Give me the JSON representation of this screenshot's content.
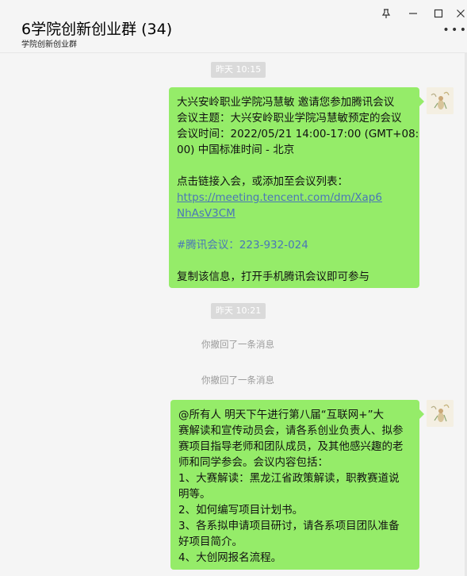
{
  "header": {
    "title": "6学院创新创业群 (34)",
    "subtitle": "学院创新创业群"
  },
  "window_controls": {
    "pin_icon": "pin-icon",
    "minimize": "—",
    "maximize": "☐",
    "close": "✕",
    "more": "⋮"
  },
  "messages": {
    "ts1": "昨天 10:15",
    "msg1": {
      "lines": [
        "大兴安岭职业学院冯慧敏 邀请您参加腾讯会议",
        "会议主题：大兴安岭职业学院冯慧敏预定的会议",
        "会议时间：2022/05/21 14:00-17:00 (GMT+08:",
        "00) 中国标准时间 - 北京",
        "点击链接入会，或添加至会议列表：",
        "https://meeting.tencent.com/dm/Xap6",
        "NhAsV3CM",
        "#腾讯会议：223-932-024",
        "复制该信息，打开手机腾讯会议即可参与"
      ]
    },
    "ts2": "昨天 10:21",
    "recall1": "你撤回了一条消息",
    "recall2": "你撤回了一条消息",
    "msg2": {
      "lines": [
        "@所有人    明天下午进行第八届“互联网+”大",
        "赛解读和宣传动员会，请各系创业负责人、拟参",
        "赛项目指导老师和团队成员，及其他感兴趣的老",
        "师和同学参会。会议内容包括：",
        "1、大赛解读：黑龙江省政策解读，职教赛道说",
        "明等。",
        "2、如何编写项目计划书。",
        "3、各系拟申请项目研讨，请各系项目团队准备",
        "好项目简介。",
        "4、大创网报名流程。"
      ]
    }
  },
  "colors": {
    "bubble": "#95ec69",
    "link": "#4a76b8",
    "background": "#f5f5f5"
  }
}
